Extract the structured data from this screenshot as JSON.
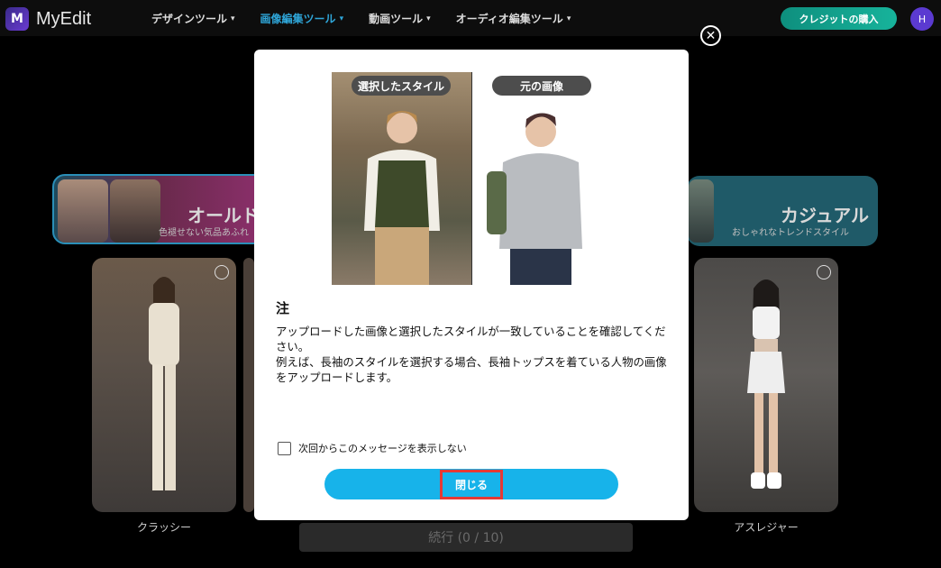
{
  "header": {
    "logo_text": "MyEdit",
    "logo_mark": "M",
    "nav": [
      {
        "label": "デザインツール"
      },
      {
        "label": "画像編集ツール"
      },
      {
        "label": "動画ツール"
      },
      {
        "label": "オーディオ編集ツール"
      }
    ],
    "buy_button": "クレジットの購入",
    "avatar_initial": "H"
  },
  "background": {
    "banner_left": {
      "title": "オールド",
      "subtitle": "色褪せない気品あふれ"
    },
    "banner_right": {
      "title": "カジュアル",
      "subtitle": "おしゃれなトレンドスタイル"
    },
    "cards": [
      {
        "label": "クラッシー"
      },
      {
        "label": "アスレジャー"
      }
    ],
    "continue_button": "続行 (0 / 10)"
  },
  "modal": {
    "selected_style_label": "選択したスタイル",
    "original_image_label": "元の画像",
    "note_title": "注",
    "note_body_1": "アップロードした画像と選択したスタイルが一致していることを確認してください。",
    "note_body_2": "例えば、長袖のスタイルを選択する場合、長袖トップスを着ている人物の画像をアップロードします。",
    "dont_show_label": "次回からこのメッセージを表示しない",
    "close_button": "閉じる"
  },
  "colors": {
    "accent_blue": "#17b3ea",
    "active_nav": "#2fa6d9",
    "buy_green": "#17b39b",
    "highlight_red": "#e53935"
  }
}
